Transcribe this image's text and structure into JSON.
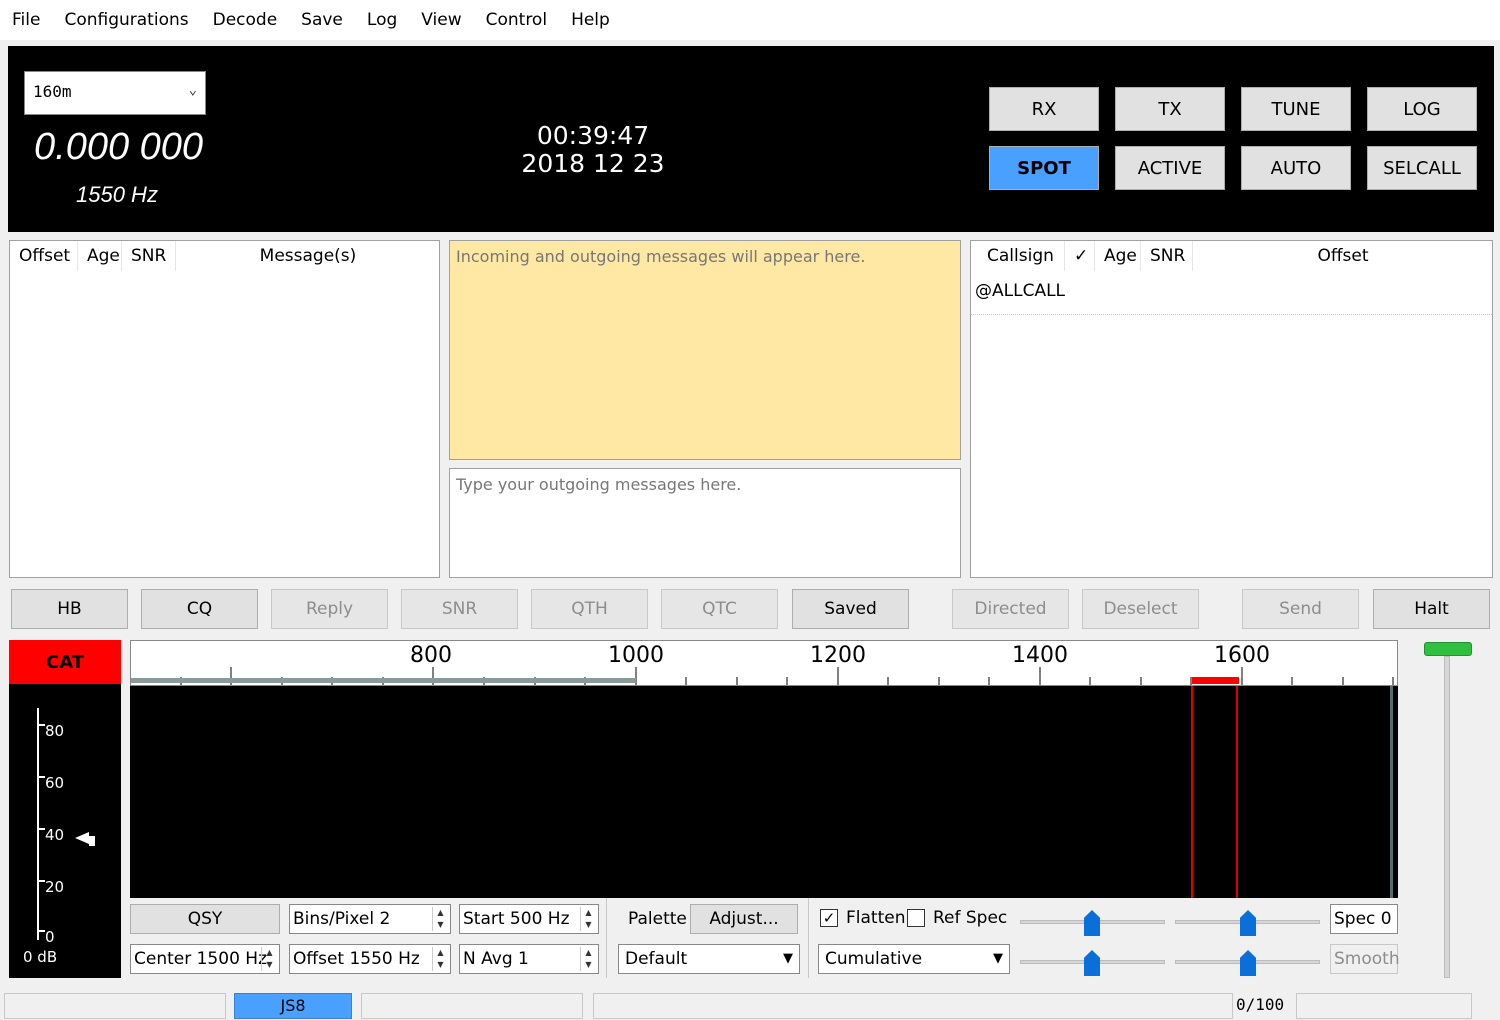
{
  "menu": [
    "File",
    "Configurations",
    "Decode",
    "Save",
    "Log",
    "View",
    "Control",
    "Help"
  ],
  "top": {
    "band": "160m",
    "dial_frequency": "0.000 000",
    "audio_offset": "1550 Hz",
    "time": "00:39:47",
    "date": "2018 12 23",
    "buttons": {
      "rx": "RX",
      "tx": "TX",
      "tune": "TUNE",
      "log": "LOG",
      "spot": "SPOT",
      "active": "ACTIVE",
      "auto": "AUTO",
      "selcall": "SELCALL"
    }
  },
  "band_activity": {
    "headers": {
      "offset": "Offset",
      "age": "Age",
      "snr": "SNR",
      "messages": "Message(s)"
    }
  },
  "messages": {
    "incoming_placeholder": "Incoming and outgoing messages will appear here.",
    "outgoing_placeholder": "Type your outgoing messages here."
  },
  "call_activity": {
    "headers": {
      "callsign": "Callsign",
      "check": "✓",
      "age": "Age",
      "snr": "SNR",
      "offset": "Offset"
    },
    "rows": [
      "@ALLCALL"
    ]
  },
  "row_buttons": {
    "hb": "HB",
    "cq": "CQ",
    "reply": "Reply",
    "snr": "SNR",
    "qth": "QTH",
    "qtc": "QTC",
    "saved": "Saved",
    "directed": "Directed",
    "deselect": "Deselect",
    "send": "Send",
    "halt": "Halt"
  },
  "cat_label": "CAT",
  "meter": {
    "ticks": [
      "80",
      "60",
      "40",
      "20",
      "0"
    ],
    "reading": "0 dB"
  },
  "waterfall": {
    "scale_labels": [
      "800",
      "1000",
      "1200",
      "1400",
      "1600"
    ]
  },
  "controls": {
    "qsy": "QSY",
    "center": "Center 1500 Hz",
    "bins": "Bins/Pixel  2",
    "offset": "Offset 1550 Hz",
    "start": "Start 500 Hz",
    "navg": "N Avg  1",
    "palette_label": "Palette",
    "adjust": "Adjust...",
    "palette_value": "Default",
    "flatten": "Flatten",
    "ref_spec": "Ref Spec",
    "spectrum_mode": "Cumulative",
    "spec": "Spec 0",
    "smooth": "Smooth"
  },
  "status": {
    "mode": "JS8",
    "progress": "0/100"
  }
}
